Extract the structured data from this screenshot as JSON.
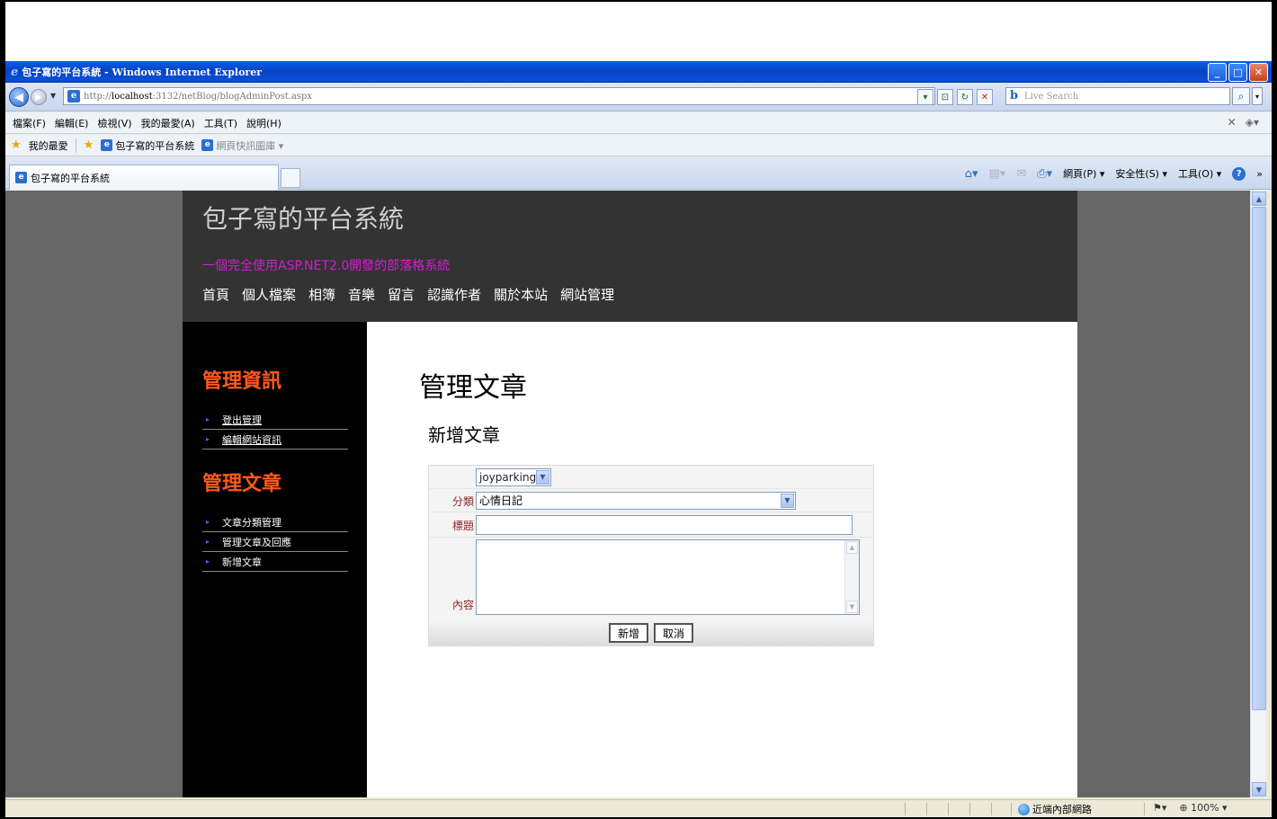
{
  "window": {
    "title": "包子寫的平台系統 - Windows Internet Explorer",
    "icon": "ie-icon",
    "buttons": [
      "_",
      "□",
      "X"
    ]
  },
  "address": {
    "url_prefix": "http://",
    "url_host": "localhost",
    "url_rest": ":3132/netBlog/blogAdminPost.aspx",
    "search_placeholder": "Live Search"
  },
  "menubar": {
    "items": [
      "檔案(F)",
      "編輯(E)",
      "檢視(V)",
      "我的最愛(A)",
      "工具(T)",
      "說明(H)"
    ]
  },
  "favorites": {
    "label": "我的最愛",
    "links": [
      "包子寫的平台系統",
      "網頁快訊圖庫 ▾"
    ]
  },
  "tab": {
    "label": "包子寫的平台系統"
  },
  "commandbar": {
    "page": "網頁(P) ▾",
    "safety": "安全性(S) ▾",
    "tools": "工具(O) ▾",
    "more": "»"
  },
  "site": {
    "title": "包子寫的平台系統",
    "subtitle": "一個完全使用ASP.NET2.0開發的部落格系統",
    "nav": [
      "首頁",
      "個人檔案",
      "相簿",
      "音樂",
      "留言",
      "認識作者",
      "關於本站",
      "網站管理"
    ]
  },
  "sidebar": {
    "section1": {
      "heading": "管理資訊",
      "items": [
        "登出管理",
        "編輯網站資訊"
      ]
    },
    "section2": {
      "heading": "管理文章",
      "items": [
        "文章分類管理",
        "管理文章及回應",
        "新增文章"
      ]
    }
  },
  "main": {
    "title": "管理文章",
    "section": "新增文章",
    "form": {
      "user_select": "joyparking",
      "category_label": "分類",
      "category_value": "心情日記",
      "title_label": "標題",
      "title_value": "",
      "content_label": "內容",
      "content_value": "",
      "submit": "新增",
      "cancel": "取消"
    }
  },
  "statusbar": {
    "zone": "近端內部網路",
    "zoom": "100%"
  },
  "colors": {
    "header_bg": "#333333",
    "sidebar_bg": "#000000",
    "sidebar_heading": "#ff5a1a",
    "subtitle": "#d41cd4",
    "page_bg": "#666666"
  }
}
